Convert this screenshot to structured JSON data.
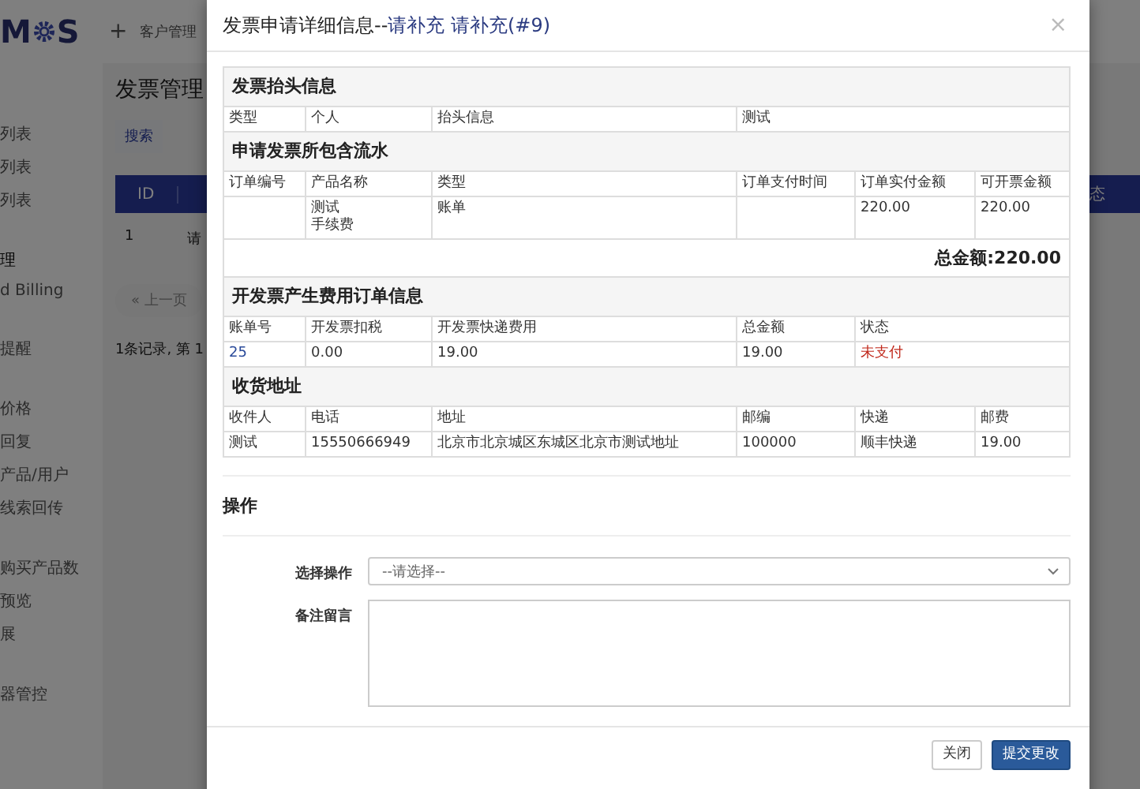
{
  "background": {
    "logo": {
      "left": "M",
      "right": "S"
    },
    "nav": {
      "add": "+",
      "item": "客户管理"
    },
    "sidebar": {
      "groups": [
        {
          "items": [
            "列表",
            "列表",
            "列表"
          ]
        },
        {
          "title": "理",
          "items": [
            "d Billing"
          ]
        },
        {
          "items": [
            "提醒"
          ]
        },
        {
          "items": [
            "价格",
            "回复",
            "产品/用户",
            "线索回传"
          ]
        },
        {
          "items": [
            "购买产品数",
            "预览",
            "展"
          ]
        },
        {
          "items": [
            "器管控"
          ]
        }
      ]
    },
    "page_title": "发票管理",
    "search_button": "搜索",
    "table": {
      "columns": [
        "ID",
        "态"
      ],
      "rows": [
        [
          "1",
          "请"
        ]
      ]
    },
    "pager": {
      "prev": "« 上一页",
      "summary": "1条记录, 第 1"
    }
  },
  "modal": {
    "title": "发票申请详细信息--",
    "title_highlight": "请补充 请补充(#9)",
    "close": "×",
    "rows": [
      {
        "kind": "section",
        "text": "发票抬头信息"
      },
      {
        "kind": "data",
        "cells": [
          {
            "text": "类型"
          },
          {
            "text": "个人"
          },
          {
            "text": "抬头信息"
          },
          {
            "text": "测试"
          }
        ]
      },
      {
        "kind": "section",
        "text": "申请发票所包含流水"
      },
      {
        "kind": "data",
        "cells": [
          {
            "text": "订单编号"
          },
          {
            "text": "产品名称"
          },
          {
            "text": "类型"
          },
          {
            "text": "订单支付时间"
          },
          {
            "text": "订单实付金额"
          },
          {
            "text": "可开票金额"
          }
        ]
      },
      {
        "kind": "data",
        "cells": [
          {},
          {
            "lines": [
              "测试",
              "手续费"
            ]
          },
          {
            "text": "账单"
          },
          {},
          {
            "text": "220.00"
          },
          {
            "text": "220.00"
          }
        ]
      },
      {
        "kind": "total",
        "text": "总金额:220.00"
      },
      {
        "kind": "section",
        "text": "开发票产生费用订单信息"
      },
      {
        "kind": "data",
        "cells": [
          {
            "text": "账单号"
          },
          {
            "text": "开发票扣税"
          },
          {
            "text": "开发票快递费用"
          },
          {
            "text": "总金额"
          },
          {
            "text": "状态"
          }
        ]
      },
      {
        "kind": "data",
        "cells": [
          {
            "text": "25",
            "kind": "link"
          },
          {
            "text": "0.00"
          },
          {
            "text": "19.00"
          },
          {
            "text": "19.00"
          },
          {
            "text": "未支付",
            "kind": "danger"
          }
        ]
      },
      {
        "kind": "section",
        "text": "收货地址"
      },
      {
        "kind": "data",
        "cells": [
          {
            "text": "收件人"
          },
          {
            "text": "电话"
          },
          {
            "text": "地址"
          },
          {
            "text": "邮编"
          },
          {
            "text": "快递"
          },
          {
            "text": "邮费"
          }
        ]
      },
      {
        "kind": "data",
        "cells": [
          {
            "text": "测试"
          },
          {
            "text": "15550666949"
          },
          {
            "text": "北京市北京城区东城区北京市测试地址"
          },
          {
            "text": "100000"
          },
          {
            "text": "顺丰快递"
          },
          {
            "text": "19.00"
          }
        ]
      }
    ],
    "operation": {
      "title": "操作",
      "select_label": "选择操作",
      "select_value": "--请选择--",
      "remark_label": "备注留言"
    },
    "buttons": [
      {
        "label": "关闭",
        "kind": "default"
      },
      {
        "label": "提交更改",
        "kind": "primary"
      }
    ]
  }
}
